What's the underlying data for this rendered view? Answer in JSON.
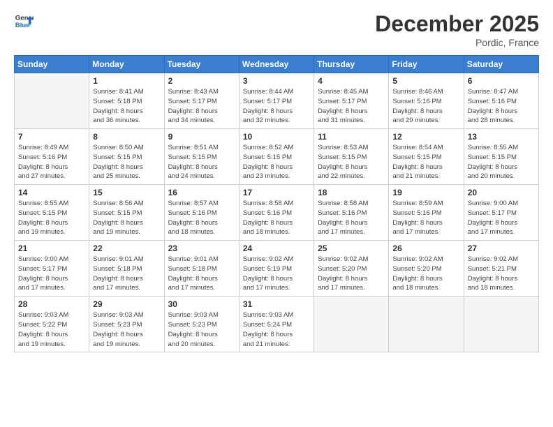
{
  "header": {
    "logo_line1": "General",
    "logo_line2": "Blue",
    "month": "December 2025",
    "location": "Pordic, France"
  },
  "weekdays": [
    "Sunday",
    "Monday",
    "Tuesday",
    "Wednesday",
    "Thursday",
    "Friday",
    "Saturday"
  ],
  "weeks": [
    [
      {
        "day": "",
        "info": ""
      },
      {
        "day": "1",
        "info": "Sunrise: 8:41 AM\nSunset: 5:18 PM\nDaylight: 8 hours\nand 36 minutes."
      },
      {
        "day": "2",
        "info": "Sunrise: 8:43 AM\nSunset: 5:17 PM\nDaylight: 8 hours\nand 34 minutes."
      },
      {
        "day": "3",
        "info": "Sunrise: 8:44 AM\nSunset: 5:17 PM\nDaylight: 8 hours\nand 32 minutes."
      },
      {
        "day": "4",
        "info": "Sunrise: 8:45 AM\nSunset: 5:17 PM\nDaylight: 8 hours\nand 31 minutes."
      },
      {
        "day": "5",
        "info": "Sunrise: 8:46 AM\nSunset: 5:16 PM\nDaylight: 8 hours\nand 29 minutes."
      },
      {
        "day": "6",
        "info": "Sunrise: 8:47 AM\nSunset: 5:16 PM\nDaylight: 8 hours\nand 28 minutes."
      }
    ],
    [
      {
        "day": "7",
        "info": "Sunrise: 8:49 AM\nSunset: 5:16 PM\nDaylight: 8 hours\nand 27 minutes."
      },
      {
        "day": "8",
        "info": "Sunrise: 8:50 AM\nSunset: 5:15 PM\nDaylight: 8 hours\nand 25 minutes."
      },
      {
        "day": "9",
        "info": "Sunrise: 8:51 AM\nSunset: 5:15 PM\nDaylight: 8 hours\nand 24 minutes."
      },
      {
        "day": "10",
        "info": "Sunrise: 8:52 AM\nSunset: 5:15 PM\nDaylight: 8 hours\nand 23 minutes."
      },
      {
        "day": "11",
        "info": "Sunrise: 8:53 AM\nSunset: 5:15 PM\nDaylight: 8 hours\nand 22 minutes."
      },
      {
        "day": "12",
        "info": "Sunrise: 8:54 AM\nSunset: 5:15 PM\nDaylight: 8 hours\nand 21 minutes."
      },
      {
        "day": "13",
        "info": "Sunrise: 8:55 AM\nSunset: 5:15 PM\nDaylight: 8 hours\nand 20 minutes."
      }
    ],
    [
      {
        "day": "14",
        "info": "Sunrise: 8:55 AM\nSunset: 5:15 PM\nDaylight: 8 hours\nand 19 minutes."
      },
      {
        "day": "15",
        "info": "Sunrise: 8:56 AM\nSunset: 5:15 PM\nDaylight: 8 hours\nand 19 minutes."
      },
      {
        "day": "16",
        "info": "Sunrise: 8:57 AM\nSunset: 5:16 PM\nDaylight: 8 hours\nand 18 minutes."
      },
      {
        "day": "17",
        "info": "Sunrise: 8:58 AM\nSunset: 5:16 PM\nDaylight: 8 hours\nand 18 minutes."
      },
      {
        "day": "18",
        "info": "Sunrise: 8:58 AM\nSunset: 5:16 PM\nDaylight: 8 hours\nand 17 minutes."
      },
      {
        "day": "19",
        "info": "Sunrise: 8:59 AM\nSunset: 5:16 PM\nDaylight: 8 hours\nand 17 minutes."
      },
      {
        "day": "20",
        "info": "Sunrise: 9:00 AM\nSunset: 5:17 PM\nDaylight: 8 hours\nand 17 minutes."
      }
    ],
    [
      {
        "day": "21",
        "info": "Sunrise: 9:00 AM\nSunset: 5:17 PM\nDaylight: 8 hours\nand 17 minutes."
      },
      {
        "day": "22",
        "info": "Sunrise: 9:01 AM\nSunset: 5:18 PM\nDaylight: 8 hours\nand 17 minutes."
      },
      {
        "day": "23",
        "info": "Sunrise: 9:01 AM\nSunset: 5:18 PM\nDaylight: 8 hours\nand 17 minutes."
      },
      {
        "day": "24",
        "info": "Sunrise: 9:02 AM\nSunset: 5:19 PM\nDaylight: 8 hours\nand 17 minutes."
      },
      {
        "day": "25",
        "info": "Sunrise: 9:02 AM\nSunset: 5:20 PM\nDaylight: 8 hours\nand 17 minutes."
      },
      {
        "day": "26",
        "info": "Sunrise: 9:02 AM\nSunset: 5:20 PM\nDaylight: 8 hours\nand 18 minutes."
      },
      {
        "day": "27",
        "info": "Sunrise: 9:02 AM\nSunset: 5:21 PM\nDaylight: 8 hours\nand 18 minutes."
      }
    ],
    [
      {
        "day": "28",
        "info": "Sunrise: 9:03 AM\nSunset: 5:22 PM\nDaylight: 8 hours\nand 19 minutes."
      },
      {
        "day": "29",
        "info": "Sunrise: 9:03 AM\nSunset: 5:23 PM\nDaylight: 8 hours\nand 19 minutes."
      },
      {
        "day": "30",
        "info": "Sunrise: 9:03 AM\nSunset: 5:23 PM\nDaylight: 8 hours\nand 20 minutes."
      },
      {
        "day": "31",
        "info": "Sunrise: 9:03 AM\nSunset: 5:24 PM\nDaylight: 8 hours\nand 21 minutes."
      },
      {
        "day": "",
        "info": ""
      },
      {
        "day": "",
        "info": ""
      },
      {
        "day": "",
        "info": ""
      }
    ]
  ]
}
